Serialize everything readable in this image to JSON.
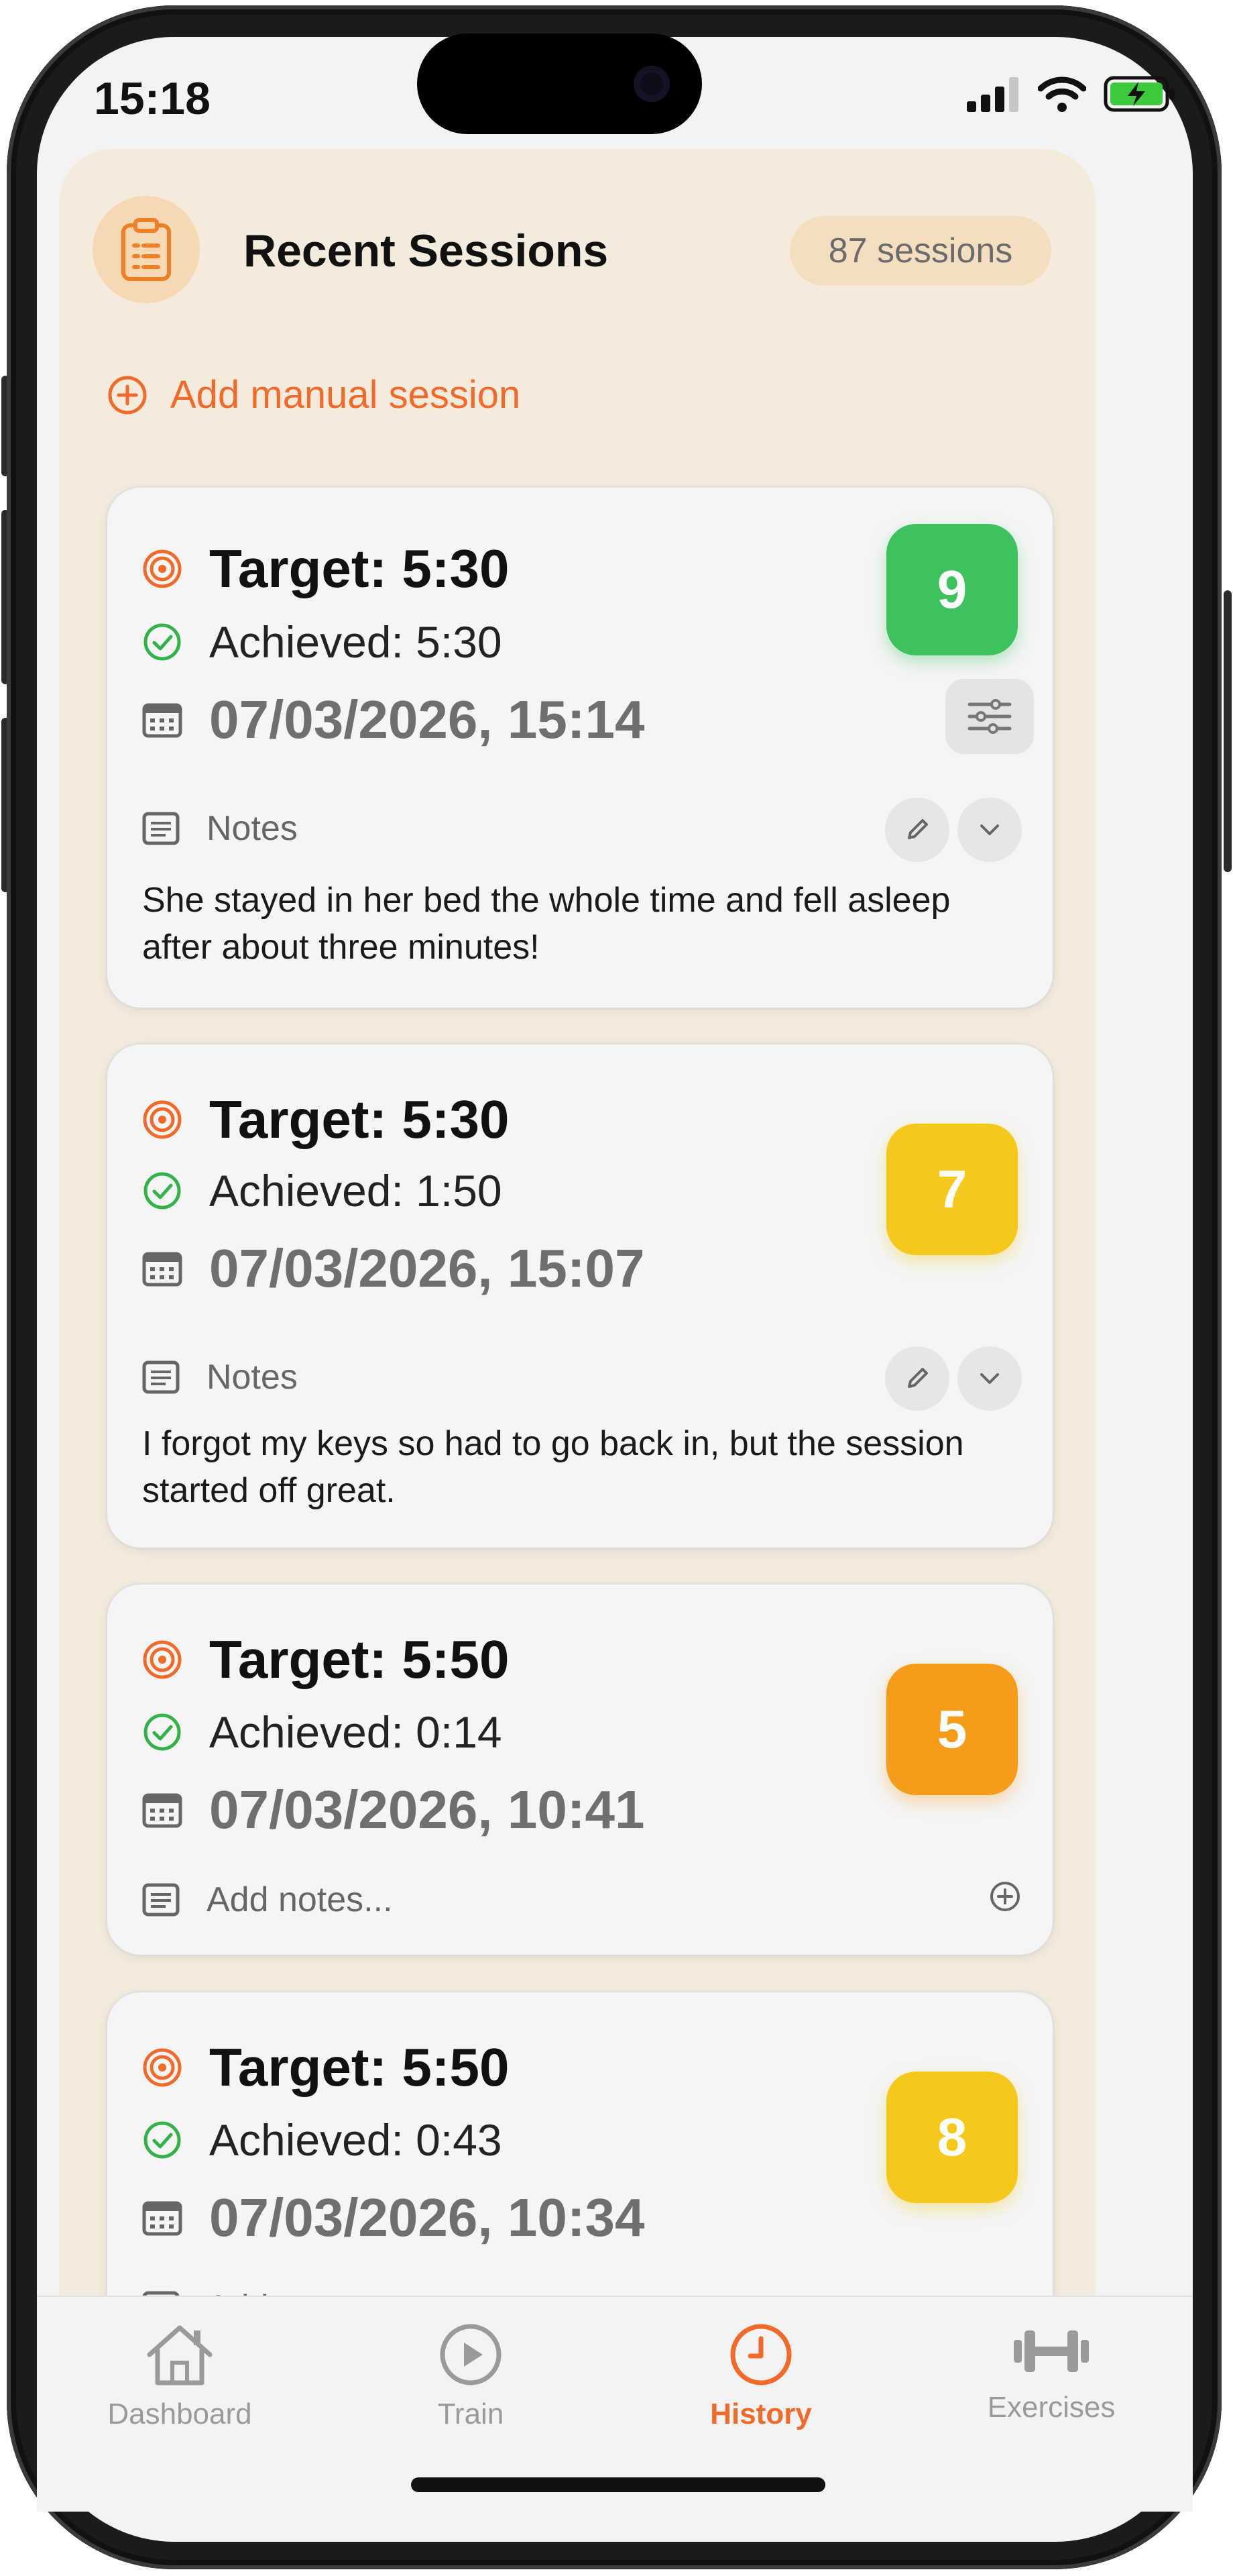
{
  "status_bar": {
    "time": "15:18"
  },
  "header": {
    "title": "Recent Sessions",
    "count": "87 sessions",
    "add_manual": "Add manual session"
  },
  "sessions": [
    {
      "target": "Target: 5:30",
      "achieved": "Achieved: 5:30",
      "datetime": "07/03/2026, 15:14",
      "score": "9",
      "score_color": "#3dc25e",
      "notes_label": "Notes",
      "notes": "She stayed in her bed the whole time and fell asleep after about three minutes!"
    },
    {
      "target": "Target: 5:30",
      "achieved": "Achieved: 1:50",
      "datetime": "07/03/2026, 15:07",
      "score": "7",
      "score_color": "#f4c91c",
      "notes_label": "Notes",
      "notes": "I forgot my keys so had to go back in, but the session started off great."
    },
    {
      "target": "Target: 5:50",
      "achieved": "Achieved: 0:14",
      "datetime": "07/03/2026, 10:41",
      "score": "5",
      "score_color": "#f59c1a",
      "notes_placeholder": "Add notes..."
    },
    {
      "target": "Target: 5:50",
      "achieved": "Achieved: 0:43",
      "datetime": "07/03/2026, 10:34",
      "score": "8",
      "score_color": "#f4c91c",
      "notes_placeholder": "Add notes..."
    }
  ],
  "tabs": [
    {
      "label": "Dashboard",
      "icon": "house-icon"
    },
    {
      "label": "Train",
      "icon": "play-circle-icon"
    },
    {
      "label": "History",
      "icon": "clock-icon",
      "active": true
    },
    {
      "label": "Exercises",
      "icon": "dumbbell-icon"
    }
  ],
  "colors": {
    "accent": "#f26a2a",
    "panel": "#f5ebdc"
  }
}
